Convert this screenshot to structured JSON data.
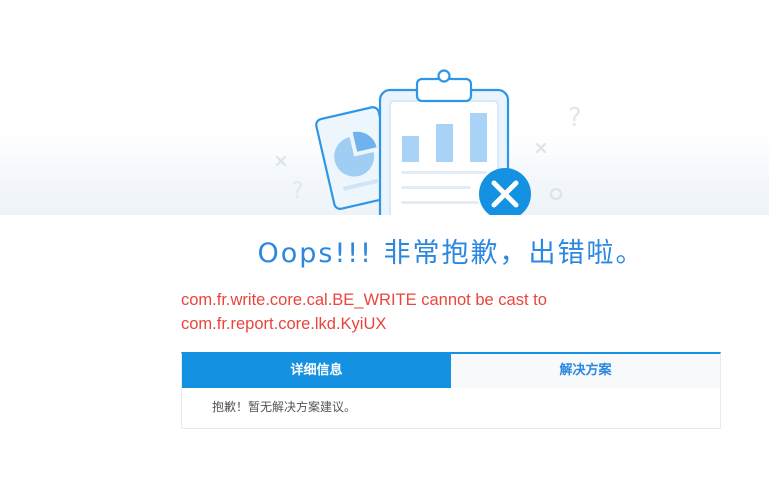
{
  "illustration": {
    "name": "error-clipboard-illustration",
    "colors": {
      "primary": "#1591e1",
      "light": "#a9d3f6",
      "soft": "#e7f2fc",
      "muted": "#dbe3eb"
    }
  },
  "page_title": "Oops!!! 非常抱歉，出错啦。",
  "error_message": "com.fr.write.core.cal.BE_WRITE cannot be cast to com.fr.report.core.lkd.KyiUX",
  "tabs": [
    {
      "label": "详细信息",
      "active": true
    },
    {
      "label": "解决方案",
      "active": false
    }
  ],
  "panel_content": "抱歉！暂无解决方案建议。",
  "colors": {
    "accent": "#1591e1",
    "title": "#2b87e0",
    "error": "#e8453c"
  }
}
